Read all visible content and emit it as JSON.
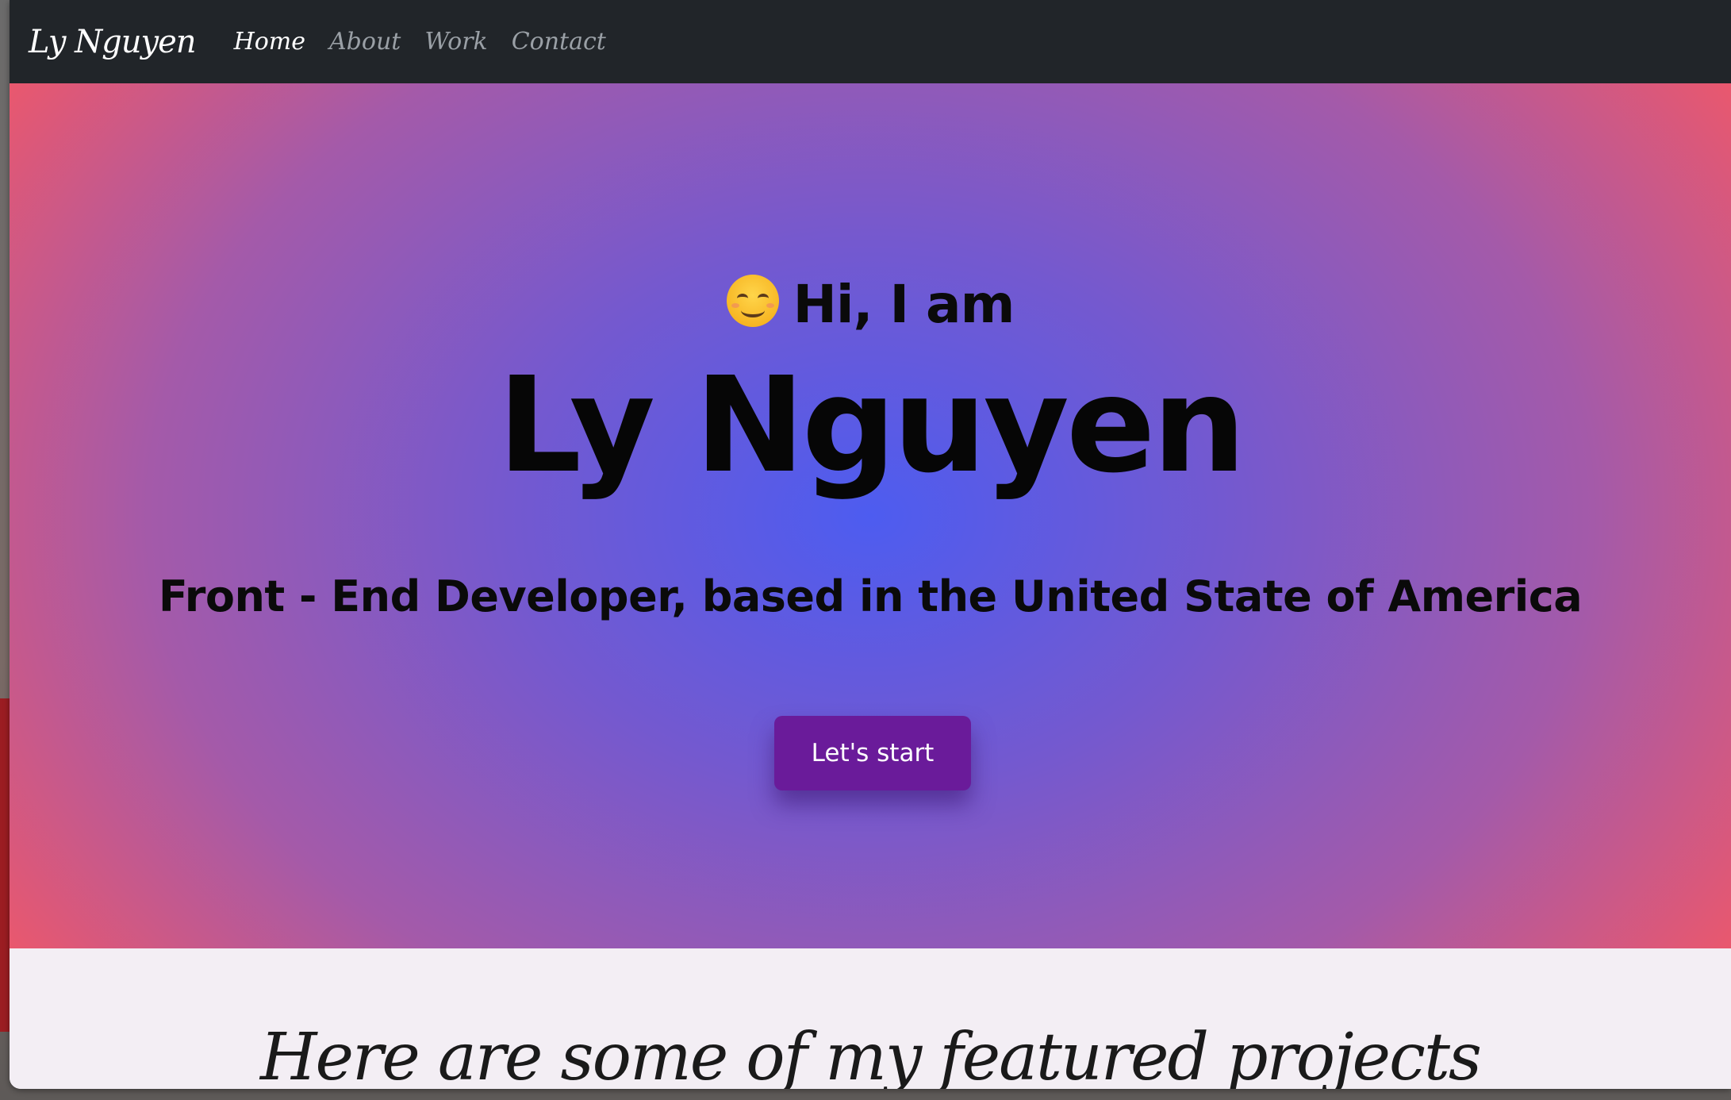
{
  "navbar": {
    "brand": "Ly Nguyen",
    "links": [
      {
        "label": "Home",
        "active": true
      },
      {
        "label": "About",
        "active": false
      },
      {
        "label": "Work",
        "active": false
      },
      {
        "label": "Contact",
        "active": false
      }
    ]
  },
  "hero": {
    "greeting_icon": "smiling-face-emoji",
    "greeting": "Hi, I am",
    "name": "Ly Nguyen",
    "role": "Front - End Developer, based in the United State of America",
    "cta_label": "Let's start"
  },
  "projects": {
    "title": "Here are some of my featured projects"
  },
  "colors": {
    "navbar_bg": "#212529",
    "hero_center": "#4d5cf0",
    "hero_edge": "#e9586e",
    "cta_bg": "#6a1b9a"
  }
}
